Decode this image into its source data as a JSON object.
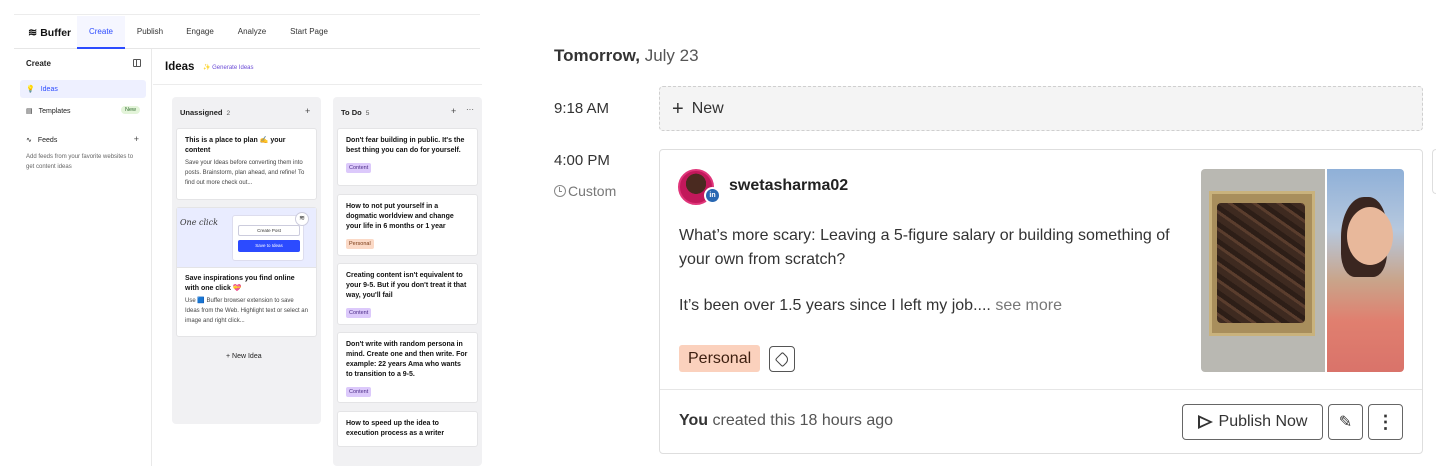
{
  "left": {
    "brand": "Buffer",
    "nav": [
      "Create",
      "Publish",
      "Engage",
      "Analyze",
      "Start Page"
    ],
    "sidebar": {
      "heading": "Create",
      "items": [
        {
          "label": "Ideas"
        },
        {
          "label": "Templates",
          "badge": "New"
        },
        {
          "label": "Feeds"
        }
      ],
      "feeds_desc": "Add feeds from your favorite websites to get content ideas"
    },
    "main": {
      "title": "Ideas",
      "generate": "Generate Ideas",
      "columns": [
        {
          "name": "Unassigned",
          "count": "2",
          "cards": [
            {
              "title": "This is a place to plan ✍ your content",
              "body": "Save your Ideas before converting them into posts. Brainstorm, plan ahead, and refine! To find out more check out..."
            },
            {
              "title": "Save inspirations you find online with one click 💝",
              "body": "Use 🟦 Buffer browser extension to save Ideas from the Web. Highlight text or select an image and right click...",
              "promo": {
                "one_click": "One click",
                "create_post": "Create Post",
                "save_to_ideas": "Save to Ideas"
              }
            }
          ],
          "new_idea": "+ New Idea"
        },
        {
          "name": "To Do",
          "count": "5",
          "cards": [
            {
              "title": "Don't fear building in public. It's the best thing you can do for yourself.",
              "tag": "Content"
            },
            {
              "title": "How to not put yourself in a dogmatic worldview and change your life in 6 months or 1 year",
              "tag": "Personal"
            },
            {
              "title": "Creating content isn't equivalent to your 9-5. But if you don't treat it that way, you'll fail",
              "tag": "Content"
            },
            {
              "title": "Don't write with random persona in mind. Create one and then write. For example: 22 years Ama who wants to transition to a 9-5.",
              "tag": "Content"
            },
            {
              "title": "How to speed up the idea to execution process as a writer"
            }
          ]
        }
      ]
    }
  },
  "right": {
    "day_label": "Tomorrow,",
    "day_date": "July 23",
    "slot1_time": "9:18 AM",
    "new_label": "New",
    "slot2_time": "4:00 PM",
    "custom_label": "Custom",
    "post": {
      "username": "swetasharma02",
      "text_1": "What’s more scary: Leaving a 5-figure salary or building something of your own from scratch?",
      "text_2": "It’s been over 1.5 years since I left my job....",
      "see_more": "see more",
      "tag": "Personal",
      "created_by": "You",
      "created_text": "created this 18 hours ago",
      "publish_label": "Publish Now"
    },
    "colors": {
      "accent": "#2c4bff",
      "personal_tag": "#fbd1bd",
      "content_tag": "#dcc9fb",
      "linkedin": "#2867b2"
    }
  }
}
